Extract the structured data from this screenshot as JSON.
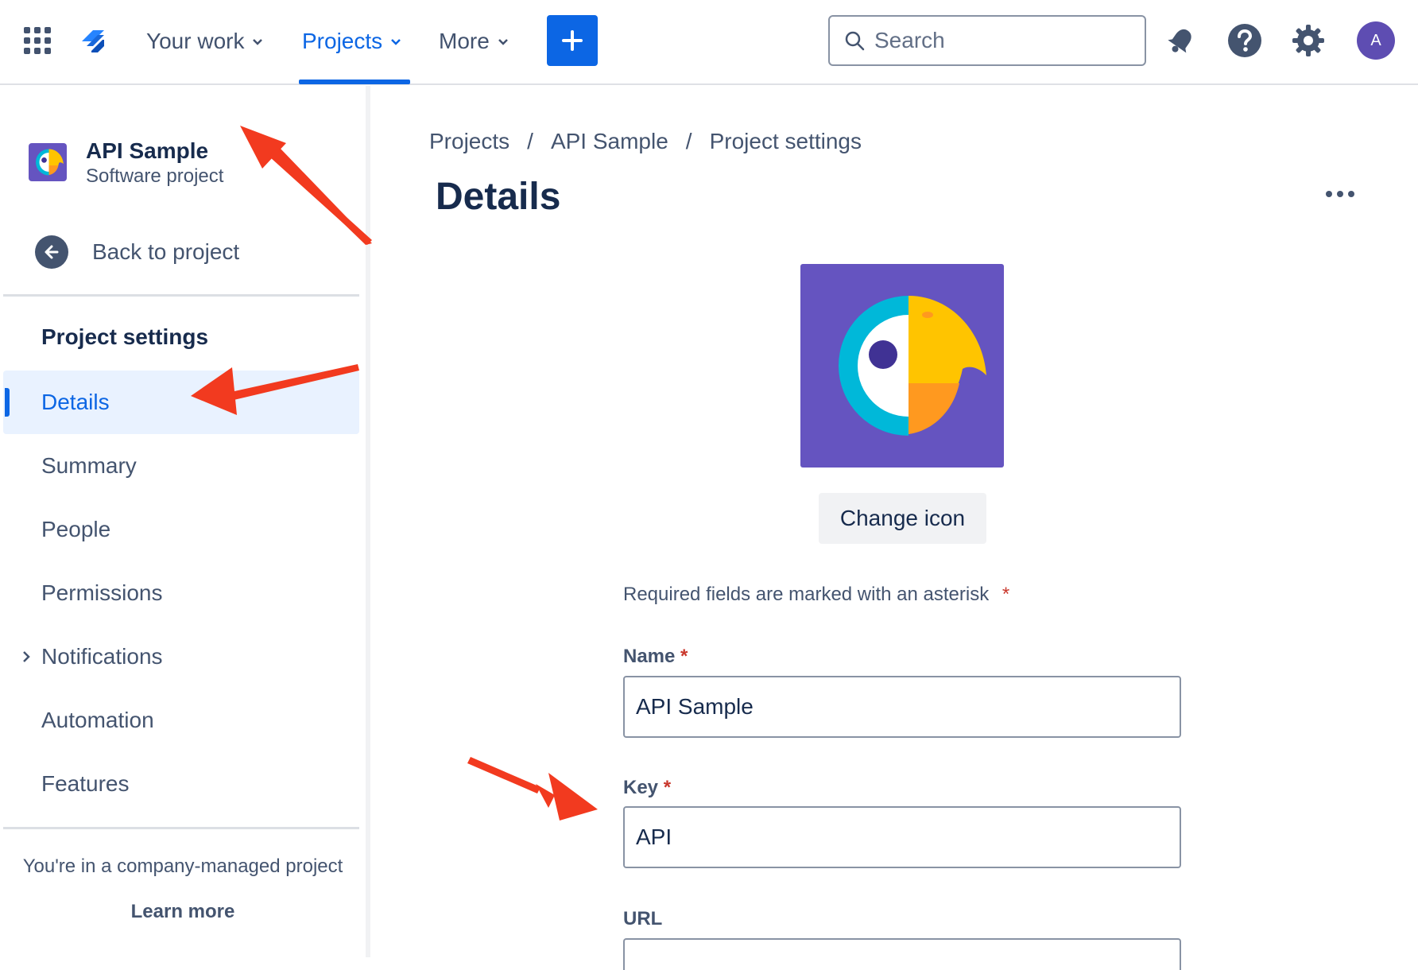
{
  "nav": {
    "your_work": "Your work",
    "projects": "Projects",
    "more": "More",
    "search_placeholder": "Search",
    "avatar_initial": "A"
  },
  "sidebar": {
    "project_name": "API Sample",
    "project_type": "Software project",
    "back_label": "Back to project",
    "section_title": "Project settings",
    "items": [
      {
        "label": "Details"
      },
      {
        "label": "Summary"
      },
      {
        "label": "People"
      },
      {
        "label": "Permissions"
      },
      {
        "label": "Notifications"
      },
      {
        "label": "Automation"
      },
      {
        "label": "Features"
      }
    ],
    "footer_note": "You're in a company-managed project",
    "learn_more": "Learn more"
  },
  "main": {
    "breadcrumbs": [
      "Projects",
      "API Sample",
      "Project settings"
    ],
    "breadcrumb_sep": "/",
    "title": "Details",
    "change_icon_label": "Change icon",
    "required_note": "Required fields are marked with an asterisk",
    "asterisk": "*",
    "fields": {
      "name": {
        "label": "Name",
        "value": "API Sample"
      },
      "key": {
        "label": "Key",
        "value": "API"
      },
      "url": {
        "label": "URL",
        "value": ""
      }
    }
  },
  "colors": {
    "accent": "#0c66e4",
    "annotation_arrow": "#f23a1f",
    "project_icon_bg": "#6554c0"
  }
}
